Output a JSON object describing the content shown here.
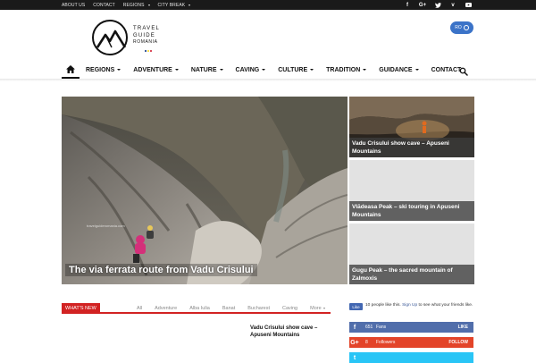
{
  "topbar": {
    "links": [
      {
        "label": "About Us",
        "dropdown": false
      },
      {
        "label": "Contact",
        "dropdown": false
      },
      {
        "label": "Regions",
        "dropdown": true
      },
      {
        "label": "City Break",
        "dropdown": true
      }
    ],
    "social_icons": [
      "facebook-icon",
      "google-plus-icon",
      "twitter-icon",
      "vimeo-icon",
      "youtube-icon"
    ]
  },
  "logo": {
    "line1": "Travel",
    "line2": "Guide",
    "line3": "Romania",
    "flag_colors": [
      "#002b7f",
      "#fcd116",
      "#ce1126"
    ]
  },
  "language": {
    "label": "RO"
  },
  "nav": {
    "items": [
      {
        "label": "Regions",
        "dropdown": true
      },
      {
        "label": "Adventure",
        "dropdown": true
      },
      {
        "label": "Nature",
        "dropdown": true
      },
      {
        "label": "Caving",
        "dropdown": true
      },
      {
        "label": "Culture",
        "dropdown": true
      },
      {
        "label": "Tradition",
        "dropdown": true
      },
      {
        "label": "Guidance",
        "dropdown": true
      },
      {
        "label": "Contact",
        "dropdown": false
      }
    ]
  },
  "hero": {
    "title": "The via ferrata route from Vadu Crisului",
    "watermark": "travelguideromania.com"
  },
  "side_posts": [
    {
      "title": "Vadu Crisului show cave – Apuseni Mountains"
    },
    {
      "title": "Vlădeasa Peak – ski touring in Apuseni Mountains"
    },
    {
      "title": "Gugu Peak – the sacred mountain of Zalmoxis"
    }
  ],
  "whats_new": {
    "label": "What's New",
    "tabs": [
      "All",
      "Adventure",
      "Alba Iulia",
      "Banat",
      "Bucharest",
      "Caving",
      "More"
    ]
  },
  "recent_post": {
    "title": "Vadu Crisului show cave – Apuseni Mountains"
  },
  "facebook_box": {
    "like_label": "Like",
    "text_before": "10 people like this.",
    "signup": "Sign Up",
    "text_after": "to see what your friends like."
  },
  "social_counters": [
    {
      "icon": "facebook-icon",
      "glyph": "f",
      "count": "651",
      "label": "Fans",
      "action": "Like",
      "color": "#516eab"
    },
    {
      "icon": "google-plus-icon",
      "glyph": "G+",
      "count": "8",
      "label": "Followers",
      "action": "Follow",
      "color": "#e34429"
    },
    {
      "icon": "twitter-icon",
      "glyph": "t",
      "count": "",
      "label": "",
      "action": "",
      "color": "#29c5f6"
    }
  ],
  "colors": {
    "accent_red": "#d22222",
    "lang_blue": "#3b73c8"
  }
}
